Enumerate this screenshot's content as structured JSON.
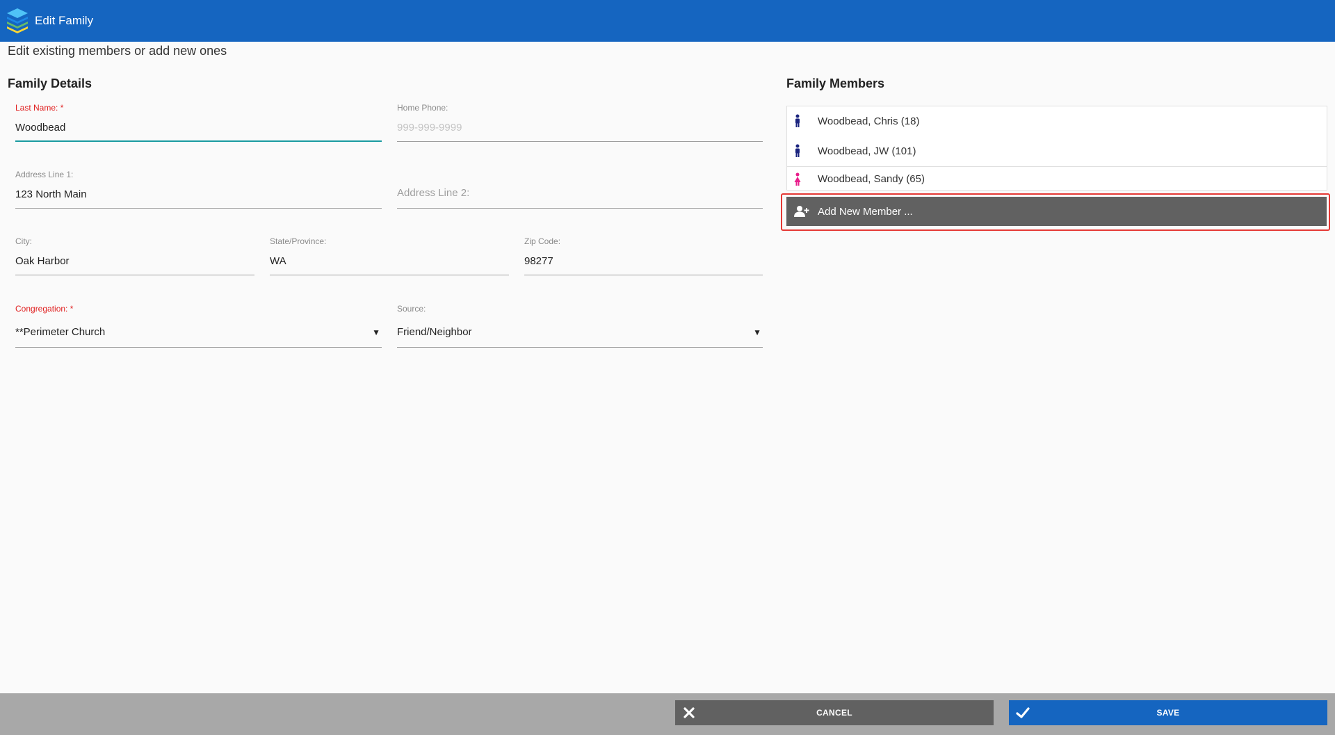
{
  "header": {
    "title": "Edit Family",
    "logo_icon": "stacked-layers-logo"
  },
  "subtitle": "Edit existing members or add new ones",
  "family_details": {
    "title": "Family Details",
    "last_name": {
      "label": "Last Name: *",
      "value": "Woodbead"
    },
    "home_phone": {
      "label": "Home Phone:",
      "placeholder": "999-999-9999"
    },
    "address1": {
      "label": "Address Line 1:",
      "value": "123 North Main"
    },
    "address2": {
      "placeholder": "Address Line 2:"
    },
    "city": {
      "label": "City:",
      "value": "Oak Harbor"
    },
    "state": {
      "label": "State/Province:",
      "value": "WA"
    },
    "zip": {
      "label": "Zip Code:",
      "value": "98277"
    },
    "congregation": {
      "label": "Congregation: *",
      "value": "**Perimeter Church"
    },
    "source": {
      "label": "Source:",
      "value": "Friend/Neighbor"
    }
  },
  "family_members": {
    "title": "Family Members",
    "items": [
      {
        "name": "Woodbead, Chris (18)",
        "icon": "male-icon",
        "color": "#1a237e"
      },
      {
        "name": "Woodbead, JW (101)",
        "icon": "male-icon",
        "color": "#1a237e"
      },
      {
        "name": "Woodbead, Sandy (65)",
        "icon": "female-icon",
        "color": "#e91e8c"
      }
    ],
    "add_label": "Add New Member ..."
  },
  "footer": {
    "cancel_label": "CANCEL",
    "save_label": "SAVE"
  },
  "colors": {
    "primary": "#1565c0",
    "danger": "#e53935",
    "button_gray": "#616161",
    "focus": "#1a9aa0"
  }
}
